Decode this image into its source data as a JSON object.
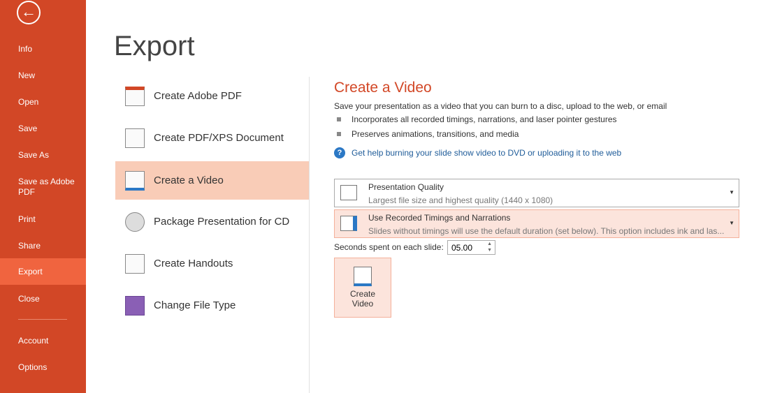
{
  "sidebar": {
    "back_icon": "arrow-left-circle-icon",
    "items": [
      {
        "label": "Info"
      },
      {
        "label": "New"
      },
      {
        "label": "Open"
      },
      {
        "label": "Save"
      },
      {
        "label": "Save As"
      },
      {
        "label": "Save as Adobe PDF"
      },
      {
        "label": "Print"
      },
      {
        "label": "Share"
      },
      {
        "label": "Export",
        "selected": true
      },
      {
        "label": "Close"
      },
      {
        "label": "Account"
      },
      {
        "label": "Options"
      }
    ],
    "colors": {
      "background": "#D24726",
      "selected": "#F0643F"
    }
  },
  "page_title": "Export",
  "export_options": [
    {
      "label": "Create Adobe PDF",
      "icon": "adobe-pdf-icon"
    },
    {
      "label": "Create PDF/XPS Document",
      "icon": "pdf-xps-icon"
    },
    {
      "label": "Create a Video",
      "icon": "video-icon",
      "selected": true
    },
    {
      "label": "Package Presentation for CD",
      "icon": "cd-icon"
    },
    {
      "label": "Create Handouts",
      "icon": "handouts-icon"
    },
    {
      "label": "Change File Type",
      "icon": "save-disk-icon"
    }
  ],
  "detail": {
    "title": "Create a Video",
    "description": "Save your presentation as a video that you can burn to a disc, upload to the web, or email",
    "bullets": [
      "Incorporates all recorded timings, narrations, and laser pointer gestures",
      "Preserves animations, transitions, and media"
    ],
    "help_link": "Get help burning your slide show video to DVD or uploading it to the web",
    "quality": {
      "title": "Presentation Quality",
      "subtitle": "Largest file size and highest quality (1440 x 1080)"
    },
    "timings": {
      "title": "Use Recorded Timings and Narrations",
      "subtitle": "Slides without timings will use the default duration (set below). This option includes ink and las..."
    },
    "seconds_label": "Seconds spent on each slide:",
    "seconds_value": "05.00",
    "create_button": {
      "line1": "Create",
      "line2": "Video"
    }
  }
}
